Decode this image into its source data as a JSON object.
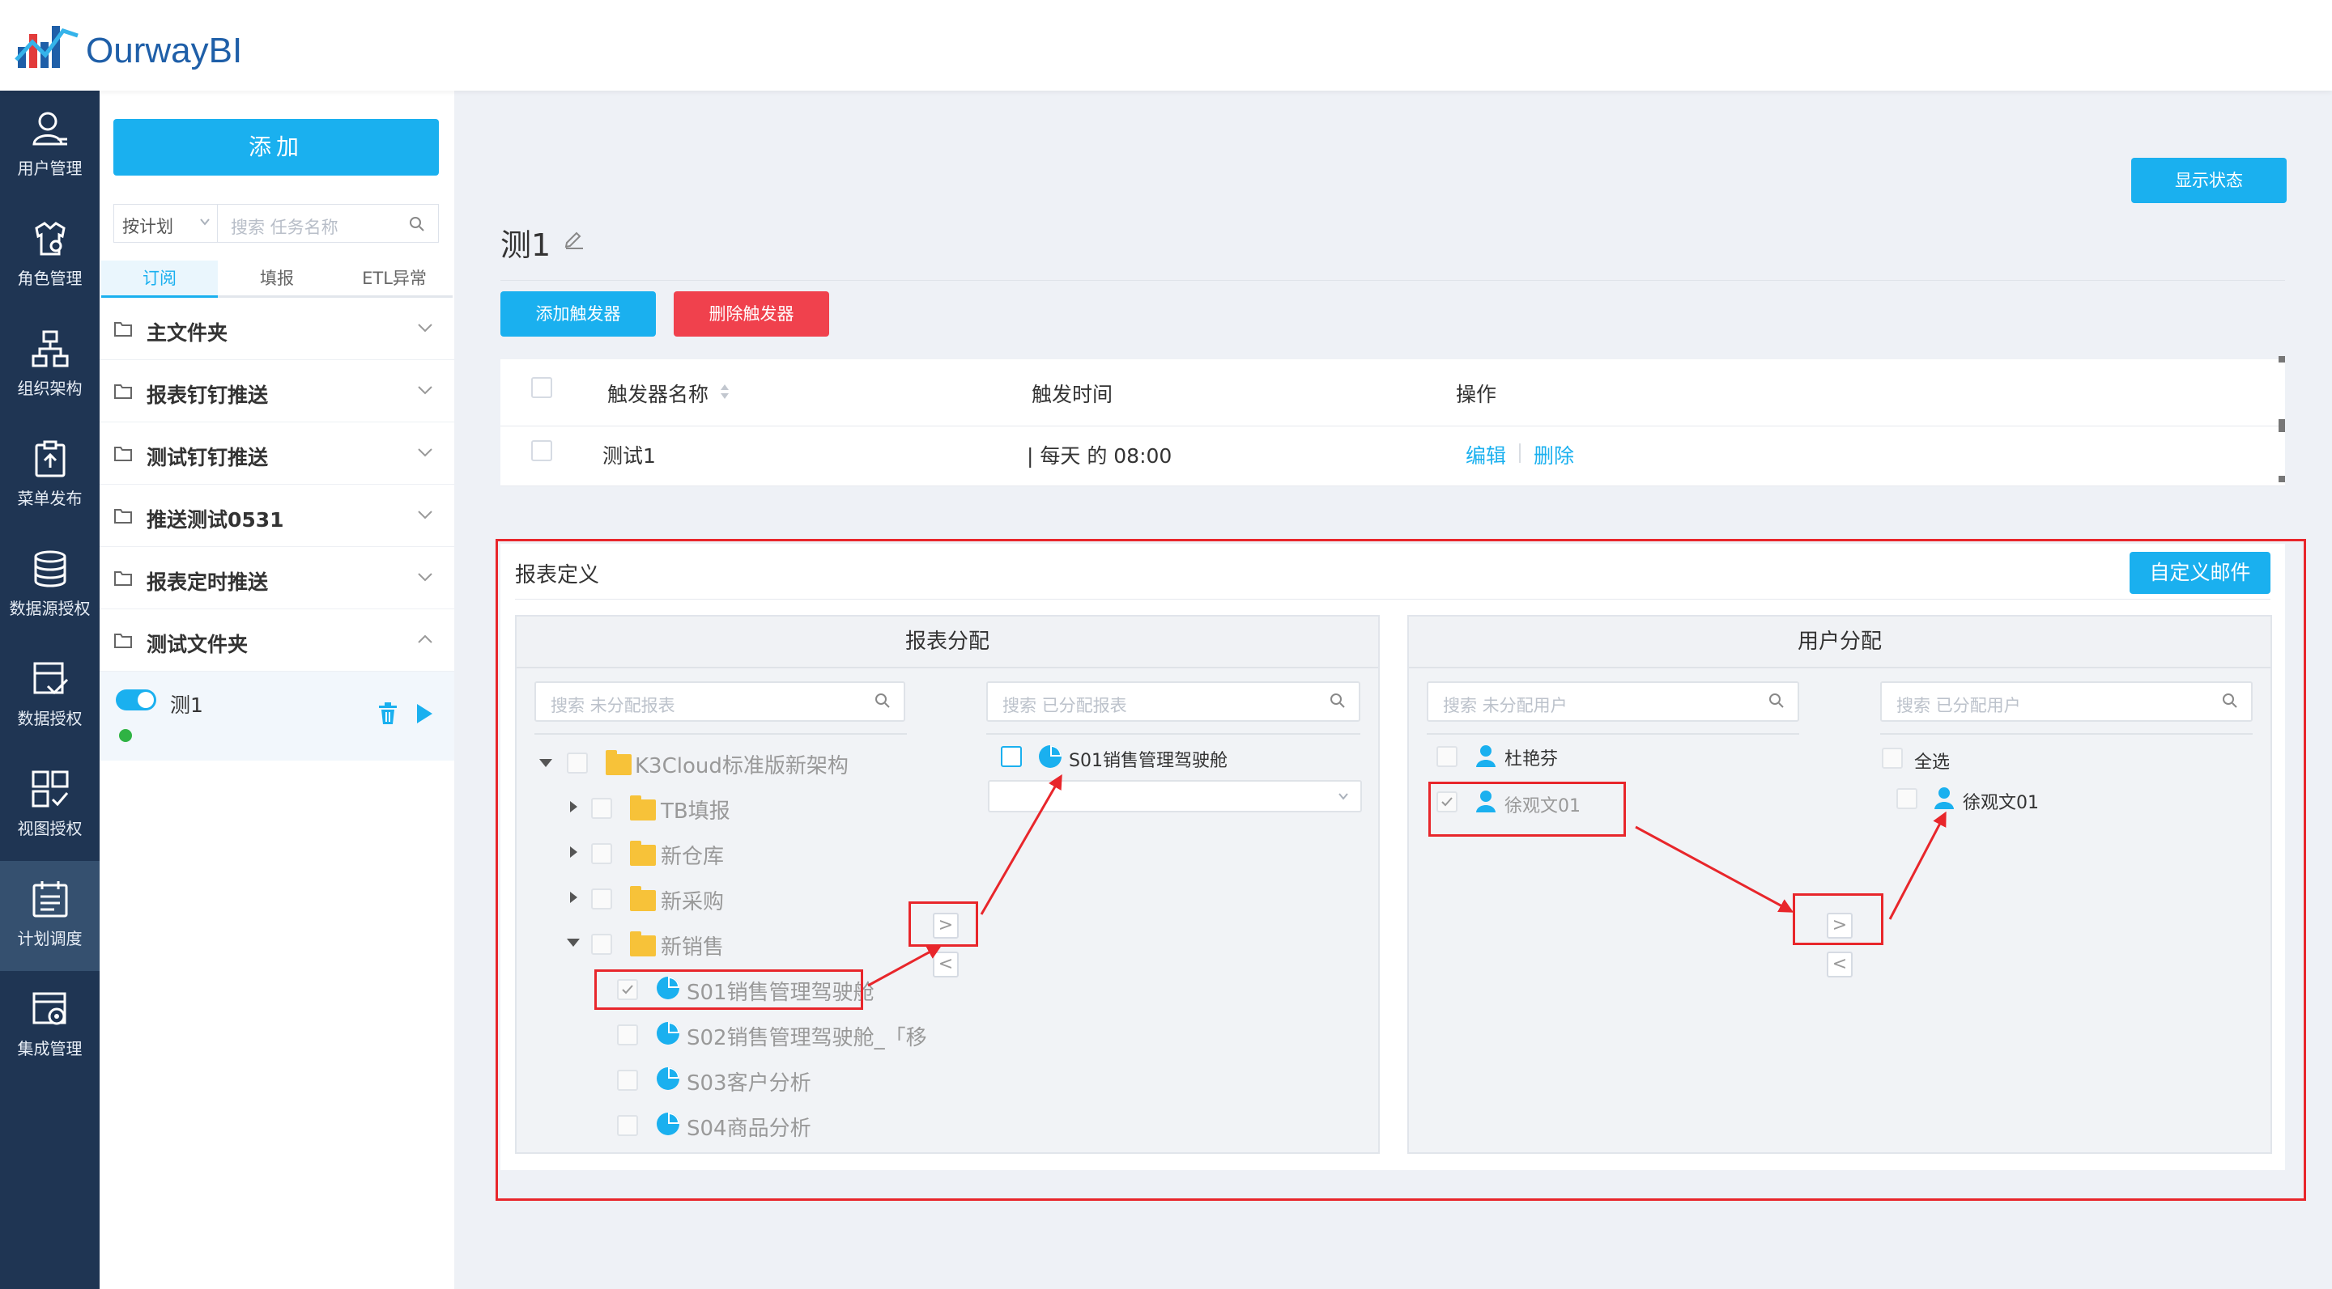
{
  "app": {
    "brand": "OurwayBI"
  },
  "leftnav": [
    {
      "id": "user",
      "label": "用户管理",
      "icon": "user-icon"
    },
    {
      "id": "role",
      "label": "角色管理",
      "icon": "role-icon"
    },
    {
      "id": "org",
      "label": "组织架构",
      "icon": "org-chart-icon"
    },
    {
      "id": "menu",
      "label": "菜单发布",
      "icon": "clipboard-upload-icon"
    },
    {
      "id": "datasource",
      "label": "数据源授权",
      "icon": "database-icon"
    },
    {
      "id": "dataauth",
      "label": "数据授权",
      "icon": "data-check-icon"
    },
    {
      "id": "viewauth",
      "label": "视图授权",
      "icon": "grid-check-icon"
    },
    {
      "id": "schedule",
      "label": "计划调度",
      "icon": "calendar-icon",
      "active": true
    },
    {
      "id": "integration",
      "label": "集成管理",
      "icon": "integration-gear-icon"
    }
  ],
  "panel": {
    "add_label": "添加",
    "plan_select": "按计划",
    "search_placeholder": "搜索 任务名称",
    "tabs": [
      "订阅",
      "填报",
      "ETL异常"
    ],
    "folders": [
      "主文件夹",
      "报表钉钉推送",
      "测试钉钉推送",
      "推送测试0531",
      "报表定时推送",
      "测试文件夹"
    ],
    "task": {
      "name": "测1",
      "enabled": true
    }
  },
  "main": {
    "display_status_label": "显示状态",
    "title": "测1",
    "add_trigger_label": "添加触发器",
    "delete_trigger_label": "删除触发器",
    "table": {
      "headers": [
        "触发器名称",
        "触发时间",
        "操作"
      ],
      "rows": [
        {
          "name": "测试1",
          "time": "| 每天 的 08:00",
          "edit": "编辑",
          "delete": "删除"
        }
      ]
    }
  },
  "report_def": {
    "title": "报表定义",
    "custom_mail_label": "自定义邮件",
    "report_assign": {
      "title": "报表分配",
      "left_placeholder": "搜索 未分配报表",
      "right_placeholder": "搜索 已分配报表",
      "tree": {
        "root": "K3Cloud标准版新架构",
        "folders": [
          "TB填报",
          "新仓库",
          "新采购",
          "新销售"
        ],
        "reports": [
          "S01销售管理驾驶舱",
          "S02销售管理驾驶舱_「移",
          "S03客户分析",
          "S04商品分析"
        ]
      },
      "assigned": [
        "S01销售管理驾驶舱"
      ],
      "move_right": ">",
      "move_left": "<"
    },
    "user_assign": {
      "title": "用户分配",
      "left_placeholder": "搜索 未分配用户",
      "right_placeholder": "搜索 已分配用户",
      "unassigned": [
        "杜艳芬",
        "徐观文01"
      ],
      "select_all": "全选",
      "assigned": [
        "徐观文01"
      ],
      "move_right": ">",
      "move_left": "<"
    }
  },
  "colors": {
    "accent": "#1ab0ef",
    "danger": "#f0414d",
    "nav_bg": "#1f3553",
    "annotation": "#e8262b"
  }
}
